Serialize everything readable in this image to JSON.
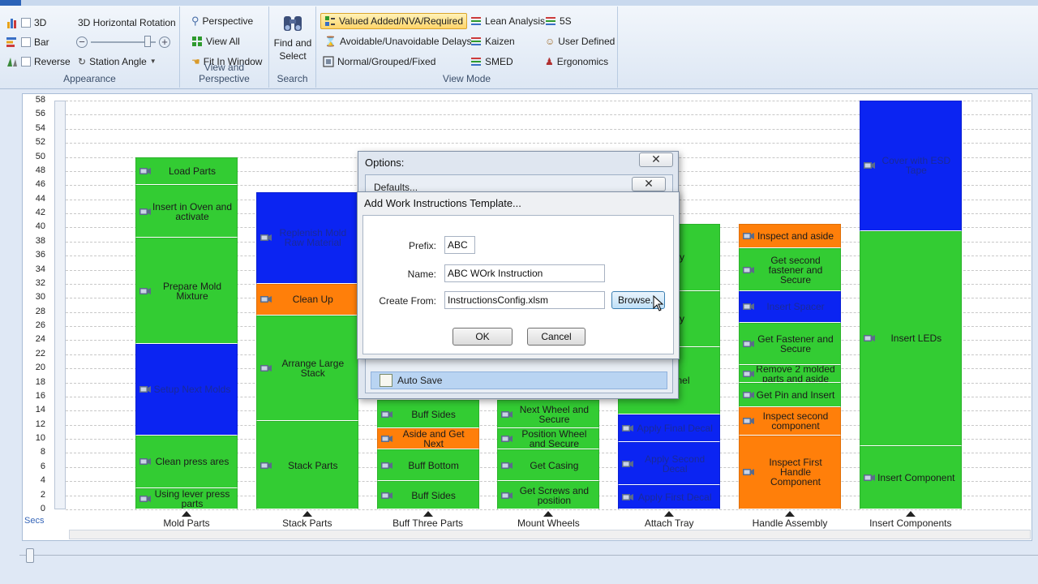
{
  "ribbon": {
    "appearance": {
      "title": "Appearance",
      "items": [
        "3D",
        "Bar",
        "Reverse"
      ],
      "rotation_label": "3D Horizontal Rotation",
      "station_angle": "Station Angle"
    },
    "view_perspective": {
      "title": "View and Perspective",
      "items": [
        "Perspective",
        "View All",
        "Fit In Window"
      ]
    },
    "search": {
      "title": "Search",
      "find_label_1": "Find and",
      "find_label_2": "Select"
    },
    "view_mode": {
      "title": "View Mode",
      "items": [
        "Valued Added/NVA/Required",
        "Avoidable/Unavoidable Delays",
        "Normal/Grouped/Fixed",
        "Lean Analysis",
        "Kaizen",
        "SMED",
        "5S",
        "User Defined",
        "Ergonomics"
      ],
      "selected": "Valued Added/NVA/Required"
    }
  },
  "chart_data": {
    "type": "bar",
    "ylabel": "Secs",
    "ylim": [
      0,
      58
    ],
    "yticks": [
      0,
      2,
      4,
      6,
      8,
      10,
      12,
      14,
      16,
      18,
      20,
      22,
      24,
      26,
      28,
      30,
      32,
      34,
      36,
      38,
      40,
      42,
      44,
      46,
      48,
      50,
      52,
      54,
      56,
      58
    ],
    "grid": true,
    "colors": {
      "green": "#33cc33",
      "blue": "#0b24f2",
      "orange": "#ff7f0a"
    },
    "categories": [
      "Mold Parts",
      "Stack Parts",
      "Buff Three Parts",
      "Mount Wheels",
      "Attach Tray",
      "Handle Assembly",
      "Insert Components"
    ],
    "stations": [
      {
        "name": "Mold Parts",
        "elements": [
          {
            "label": "Using lever press parts",
            "start": 0,
            "end": 3,
            "color": "green"
          },
          {
            "label": "Clean press ares",
            "start": 3,
            "end": 10.5,
            "color": "green"
          },
          {
            "label": "Setup Next Molds",
            "start": 10.5,
            "end": 23.5,
            "color": "blue"
          },
          {
            "label": "Prepare Mold Mixture",
            "start": 23.5,
            "end": 38.5,
            "color": "green"
          },
          {
            "label": "Insert in Oven and activate",
            "start": 38.5,
            "end": 46,
            "color": "green"
          },
          {
            "label": "Load Parts",
            "start": 46,
            "end": 50,
            "color": "green"
          }
        ]
      },
      {
        "name": "Stack Parts",
        "elements": [
          {
            "label": "Stack Parts",
            "start": 0,
            "end": 12.5,
            "color": "green"
          },
          {
            "label": "Arrange Large Stack",
            "start": 12.5,
            "end": 27.5,
            "color": "green"
          },
          {
            "label": "Clean Up",
            "start": 27.5,
            "end": 32,
            "color": "orange"
          },
          {
            "label": "Replenish Mold Raw Material",
            "start": 32,
            "end": 45,
            "color": "blue"
          }
        ]
      },
      {
        "name": "Buff Three Parts",
        "elements": [
          {
            "label": "Buff Sides",
            "start": 0,
            "end": 4,
            "color": "green"
          },
          {
            "label": "Buff Bottom",
            "start": 4,
            "end": 8.5,
            "color": "green"
          },
          {
            "label": "Aside and Get Next",
            "start": 8.5,
            "end": 11.5,
            "color": "orange"
          },
          {
            "label": "Buff Sides",
            "start": 11.5,
            "end": 15.5,
            "color": "green"
          }
        ]
      },
      {
        "name": "Mount Wheels",
        "elements": [
          {
            "label": "Get Screws and position",
            "start": 0,
            "end": 4,
            "color": "green"
          },
          {
            "label": "Get Casing",
            "start": 4,
            "end": 8.5,
            "color": "green"
          },
          {
            "label": "Position Wheel and Secure",
            "start": 8.5,
            "end": 11.5,
            "color": "green"
          },
          {
            "label": "Next Wheel and Secure",
            "start": 11.5,
            "end": 15.5,
            "color": "green"
          }
        ]
      },
      {
        "name": "Attach Tray",
        "elements": [
          {
            "label": "Apply First Decal",
            "start": 0,
            "end": 3.5,
            "color": "blue"
          },
          {
            "label": "Apply Second Decal",
            "start": 3.5,
            "end": 9.5,
            "color": "blue"
          },
          {
            "label": "Apply Final Decal",
            "start": 9.5,
            "end": 13.5,
            "color": "blue"
          },
          {
            "label": "Funnel",
            "start": 13.5,
            "end": 23,
            "color": "green"
          },
          {
            "label": "Tray",
            "start": 23,
            "end": 31,
            "color": "green"
          },
          {
            "label": "Tray",
            "start": 31,
            "end": 40.5,
            "color": "green"
          }
        ]
      },
      {
        "name": "Handle Assembly",
        "elements": [
          {
            "label": "Inspect First Handle Component",
            "start": 0,
            "end": 10.5,
            "color": "orange"
          },
          {
            "label": "Inspect second component",
            "start": 10.5,
            "end": 14.5,
            "color": "orange"
          },
          {
            "label": "Get Pin and Insert",
            "start": 14.5,
            "end": 18,
            "color": "green"
          },
          {
            "label": "Remove 2 molded parts and aside",
            "start": 18,
            "end": 20.5,
            "color": "green"
          },
          {
            "label": "Get Fastener and Secure",
            "start": 20.5,
            "end": 26.5,
            "color": "green"
          },
          {
            "label": "Insert Spacer",
            "start": 26.5,
            "end": 31,
            "color": "blue"
          },
          {
            "label": "Get second fastener and Secure",
            "start": 31,
            "end": 37,
            "color": "green"
          },
          {
            "label": "Inspect and aside",
            "start": 37,
            "end": 40.5,
            "color": "orange"
          }
        ]
      },
      {
        "name": "Insert Components",
        "elements": [
          {
            "label": "Insert Component",
            "start": 0,
            "end": 9,
            "color": "green"
          },
          {
            "label": "Insert LEDs",
            "start": 9,
            "end": 39.5,
            "color": "green"
          },
          {
            "label": "Cover with ESD Tape",
            "start": 39.5,
            "end": 58,
            "color": "blue"
          }
        ]
      }
    ]
  },
  "options_dialog": {
    "title": "Options:",
    "inner_title": "Defaults...",
    "auto_save": "Auto Save"
  },
  "template_dialog": {
    "title": "Add Work Instructions Template...",
    "prefix_label": "Prefix:",
    "prefix_value": "ABC",
    "name_label": "Name:",
    "name_value": "ABC WOrk Instruction",
    "create_from_label": "Create From:",
    "create_from_value": "InstructionsConfig.xlsm",
    "browse_label": "Browse...",
    "ok_label": "OK",
    "cancel_label": "Cancel"
  }
}
